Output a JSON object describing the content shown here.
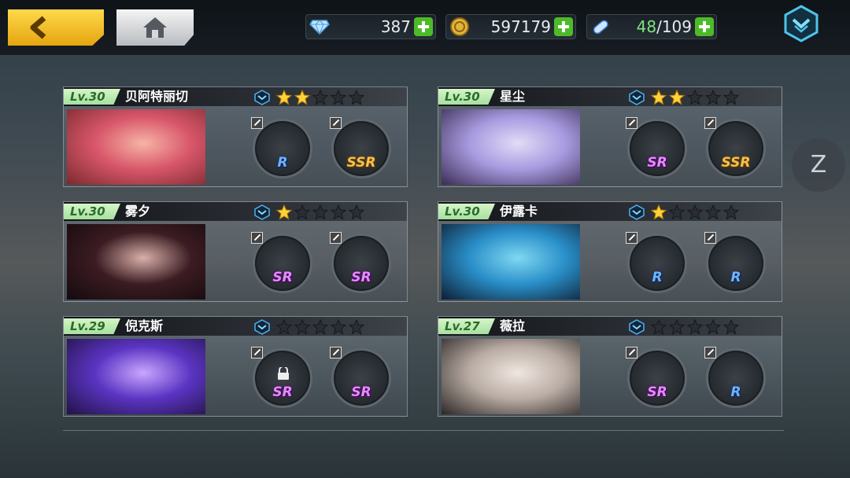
{
  "topbar": {
    "back_icon": "chevron-left-icon",
    "home_icon": "home-icon",
    "resources": [
      {
        "icon": "diamond-icon",
        "value": "387"
      },
      {
        "icon": "gold-coin-icon",
        "value": "597179"
      },
      {
        "icon": "stamina-capsule-icon",
        "current": "48",
        "sep": "/",
        "max": "109"
      }
    ],
    "menu_icon": "dropdown-chevron-icon"
  },
  "side": {
    "z_label": "Z"
  },
  "colors": {
    "level_green": "#a7e0a0",
    "gold_star": "#ffd23a",
    "rank_blue": "#2d7fd6"
  },
  "characters": [
    {
      "level": "Lv.30",
      "name": "贝阿特丽切",
      "stars": 2,
      "weapons": [
        {
          "rarity": "R"
        },
        {
          "rarity": "SSR"
        }
      ],
      "portrait": "pink-hair-portrait"
    },
    {
      "level": "Lv.30",
      "name": "星尘",
      "stars": 2,
      "weapons": [
        {
          "rarity": "SR"
        },
        {
          "rarity": "SSR"
        }
      ],
      "portrait": "lavender-hair-portrait"
    },
    {
      "level": "Lv.30",
      "name": "雾夕",
      "stars": 1,
      "weapons": [
        {
          "rarity": "SR"
        },
        {
          "rarity": "SR"
        }
      ],
      "portrait": "dark-hair-portrait"
    },
    {
      "level": "Lv.30",
      "name": "伊露卡",
      "stars": 1,
      "weapons": [
        {
          "rarity": "R"
        },
        {
          "rarity": "R"
        }
      ],
      "portrait": "blue-hair-portrait"
    },
    {
      "level": "Lv.29",
      "name": "倪克斯",
      "stars": 0,
      "weapons": [
        {
          "rarity": "SR",
          "locked": true
        },
        {
          "rarity": "SR"
        }
      ],
      "portrait": "purple-hair-portrait"
    },
    {
      "level": "Lv.27",
      "name": "薇拉",
      "stars": 0,
      "weapons": [
        {
          "rarity": "SR"
        },
        {
          "rarity": "R"
        }
      ],
      "portrait": "white-hair-portrait"
    }
  ]
}
